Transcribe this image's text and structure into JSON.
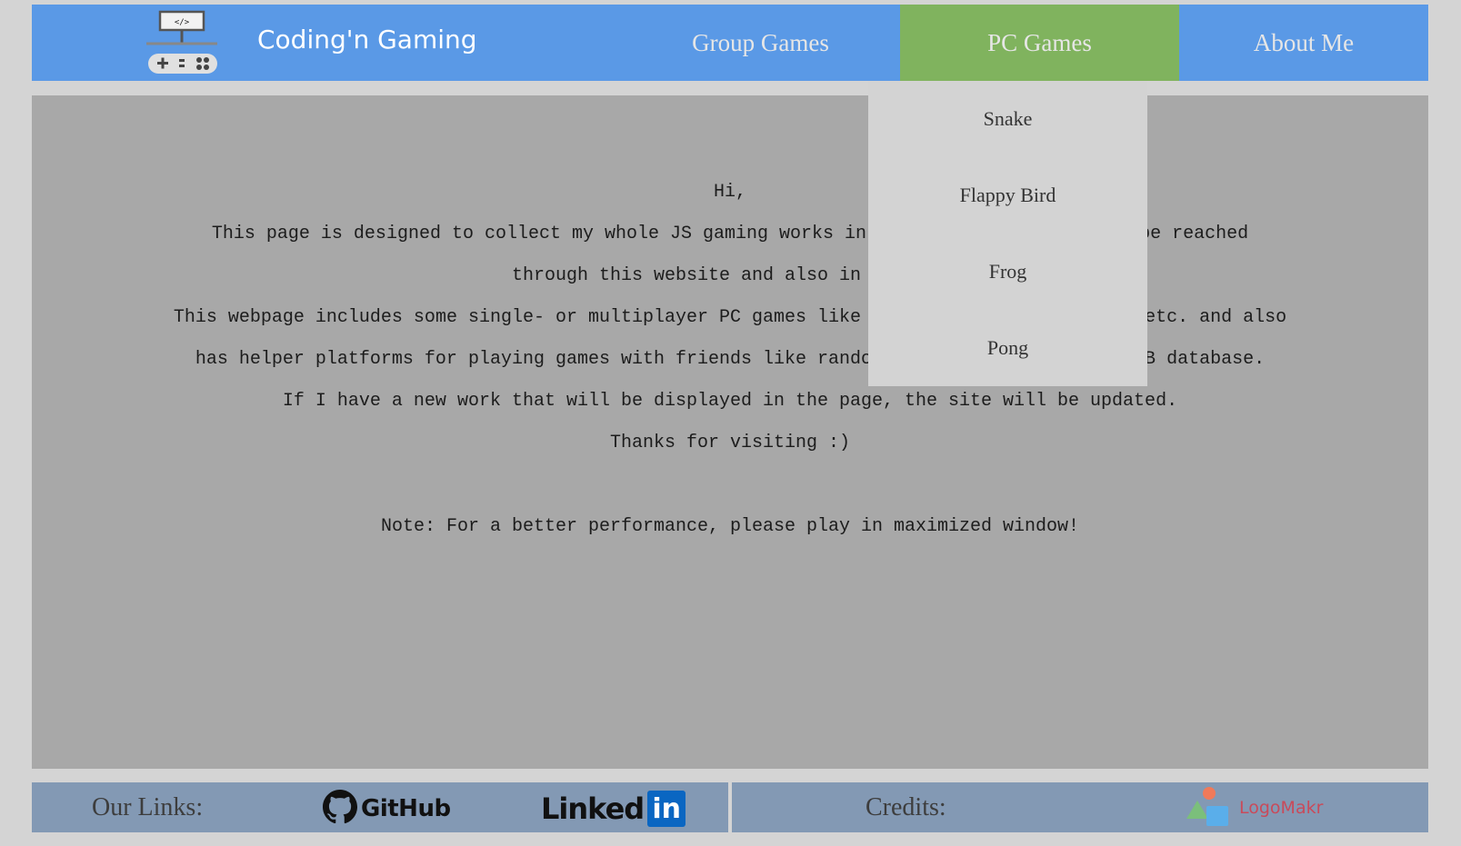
{
  "header": {
    "title": "Coding'n Gaming",
    "logo_icon": "gamepad-code-icon",
    "nav": [
      {
        "label": "Group Games"
      },
      {
        "label": "PC Games",
        "active": true,
        "active_color": "#80b35e"
      },
      {
        "label": "About Me"
      }
    ],
    "color": "#5a99e6"
  },
  "dropdown": {
    "items": [
      "Snake",
      "Flappy Bird",
      "Frog",
      "Pong"
    ]
  },
  "content": {
    "greeting": "Hi,",
    "para1": "This page is designed to collect my whole JS gaming works in a single place that can be reached through this website and also in GitHub.",
    "para2": "This webpage includes some single- or multiplayer PC games like snake, pong, flying bird etc. and also has helper platforms for playing games with friends like random movie selector from IMDB database.",
    "para3": "If I have a new work that will be displayed in the page, the site will be updated.",
    "para4": "Thanks for visiting :)",
    "note": "Note: For a better performance, please play in maximized window!"
  },
  "footer": {
    "links_label": "Our Links:",
    "github_label": "GitHub",
    "linkedin_label": "Linked",
    "linkedin_box": "in",
    "credits_label": "Credits:",
    "logomakr_label": "LogoMakr"
  }
}
